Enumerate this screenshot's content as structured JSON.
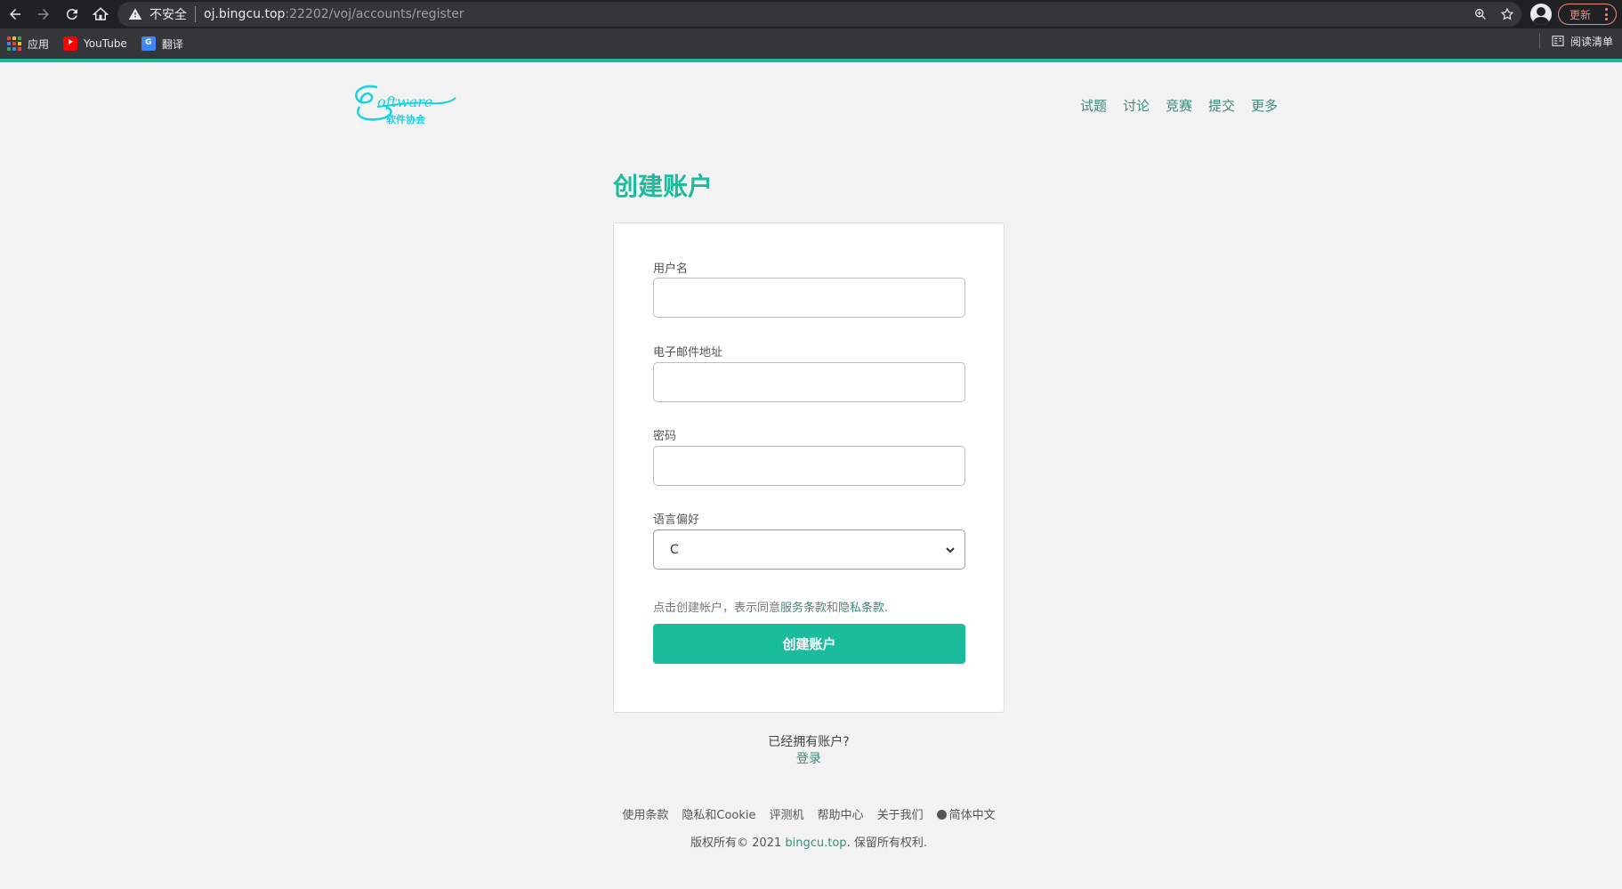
{
  "browser": {
    "insecure_label": "不安全",
    "url_host": "oj.bingcu.top",
    "url_rest": ":22202/voj/accounts/register",
    "update_label": "更新",
    "bookmarks": [
      {
        "label": "应用",
        "icon": "apps-icon"
      },
      {
        "label": "YouTube",
        "icon": "youtube-icon"
      },
      {
        "label": "翻译",
        "icon": "translate-icon"
      }
    ],
    "reading_list": "阅读清单"
  },
  "site": {
    "logo_alt": "Software 软件协会",
    "nav": [
      "试题",
      "讨论",
      "竞赛",
      "提交",
      "更多"
    ]
  },
  "form": {
    "title": "创建账户",
    "username_label": "用户名",
    "email_label": "电子邮件地址",
    "password_label": "密码",
    "language_label": "语言偏好",
    "language_value": "C",
    "terms_prefix": "点击创建帐户，表示同意",
    "terms_link": "服务条款",
    "terms_and": "和",
    "privacy_link": "隐私条款",
    "terms_suffix": ".",
    "submit_label": "创建账户",
    "have_account": "已经拥有账户?",
    "login_label": "登录"
  },
  "footer": {
    "links": [
      "使用条款",
      "隐私和Cookie",
      "评测机",
      "帮助中心",
      "关于我们"
    ],
    "language": "简体中文",
    "copyright_prefix": "版权所有© 2021 ",
    "copyright_link": "bingcu.top",
    "copyright_suffix": ". 保留所有权利."
  },
  "colors": {
    "accent": "#1abc9c",
    "link": "#3d8b78",
    "chrome_dark": "#202124"
  }
}
